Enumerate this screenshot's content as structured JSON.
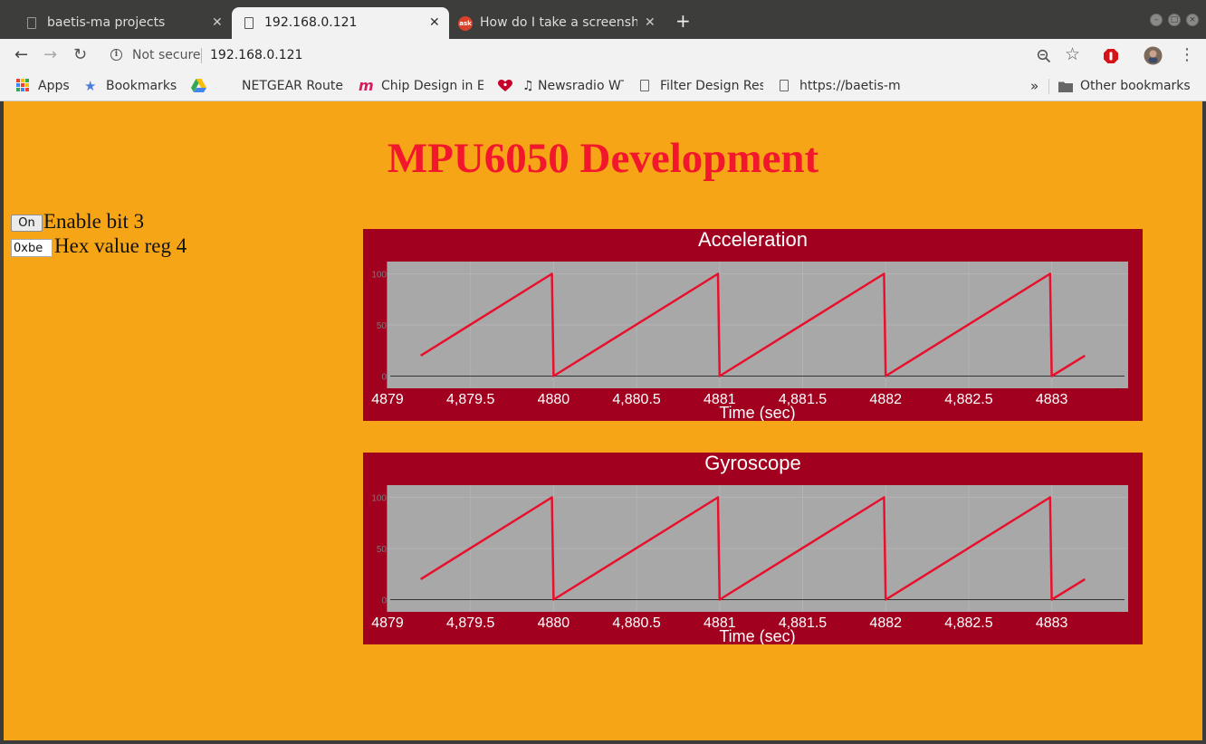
{
  "browser": {
    "tabs": [
      {
        "title": "baetis-ma projects",
        "icon": "document-icon",
        "active": false
      },
      {
        "title": "192.168.0.121",
        "icon": "document-icon",
        "active": true
      },
      {
        "title": "How do I take a screensho",
        "icon": "ask-ubuntu-icon",
        "active": false
      }
    ],
    "new_tab_symbol": "+",
    "close_symbol": "✕",
    "security_label": "Not secure",
    "url": "192.168.0.121",
    "bookmarks": [
      {
        "label": "Apps",
        "icon": "apps-grid-icon"
      },
      {
        "label": "Bookmarks",
        "icon": "star-icon"
      },
      {
        "label": "NETGEAR Router",
        "icon": "google-drive-icon"
      },
      {
        "label": "Chip Design in Ea",
        "icon": "m-logo-icon"
      },
      {
        "label": "♫ Newsradio WT",
        "icon": "iheartradio-icon"
      },
      {
        "label": "Filter Design Res",
        "icon": "document-icon"
      },
      {
        "label": "https://baetis-m",
        "icon": "document-icon"
      }
    ],
    "overflow_symbol": "»",
    "other_bookmarks": "Other bookmarks"
  },
  "page": {
    "title": "MPU6050 Development",
    "bit_button_label": "On",
    "bit_label": "Enable bit 3",
    "reg_value": "0xbe",
    "reg_label": "Hex value reg 4",
    "colors": {
      "background": "#f5a516",
      "title": "#f2172c",
      "chart_bg": "#a1001e",
      "plot_bg": "#a8a8a8",
      "line": "#e8102c"
    }
  },
  "chart_data": [
    {
      "type": "line",
      "title": "Acceleration",
      "xlabel": "Time (sec)",
      "ylabel": "",
      "xlim": [
        4879,
        4883.46
      ],
      "ylim": [
        -12,
        112
      ],
      "xticks": [
        4879,
        4879.5,
        4880,
        4880.5,
        4881,
        4881.5,
        4882,
        4882.5,
        4883
      ],
      "xtick_labels": [
        "4879",
        "4,879.5",
        "4880",
        "4,880.5",
        "4881",
        "4,881.5",
        "4882",
        "4,882.5",
        "4883"
      ],
      "yticks": [
        0,
        50,
        100
      ],
      "ytick_labels": [
        "0",
        "50",
        "100"
      ],
      "grid": true,
      "series": [
        {
          "x": [
            4879.2,
            4879.99,
            4880.0,
            4880.99,
            4881.0,
            4881.99,
            4882.0,
            4882.99,
            4883.0,
            4883.2
          ],
          "y": [
            20,
            100,
            0,
            100,
            0,
            100,
            0,
            100,
            0,
            20
          ]
        }
      ]
    },
    {
      "type": "line",
      "title": "Gyroscope",
      "xlabel": "Time (sec)",
      "ylabel": "",
      "xlim": [
        4879,
        4883.46
      ],
      "ylim": [
        -12,
        112
      ],
      "xticks": [
        4879,
        4879.5,
        4880,
        4880.5,
        4881,
        4881.5,
        4882,
        4882.5,
        4883
      ],
      "xtick_labels": [
        "4879",
        "4,879.5",
        "4880",
        "4,880.5",
        "4881",
        "4,881.5",
        "4882",
        "4,882.5",
        "4883"
      ],
      "yticks": [
        0,
        50,
        100
      ],
      "ytick_labels": [
        "0",
        "50",
        "100"
      ],
      "grid": true,
      "series": [
        {
          "x": [
            4879.2,
            4879.99,
            4880.0,
            4880.99,
            4881.0,
            4881.99,
            4882.0,
            4882.99,
            4883.0,
            4883.2
          ],
          "y": [
            20,
            100,
            0,
            100,
            0,
            100,
            0,
            100,
            0,
            20
          ]
        }
      ]
    }
  ]
}
